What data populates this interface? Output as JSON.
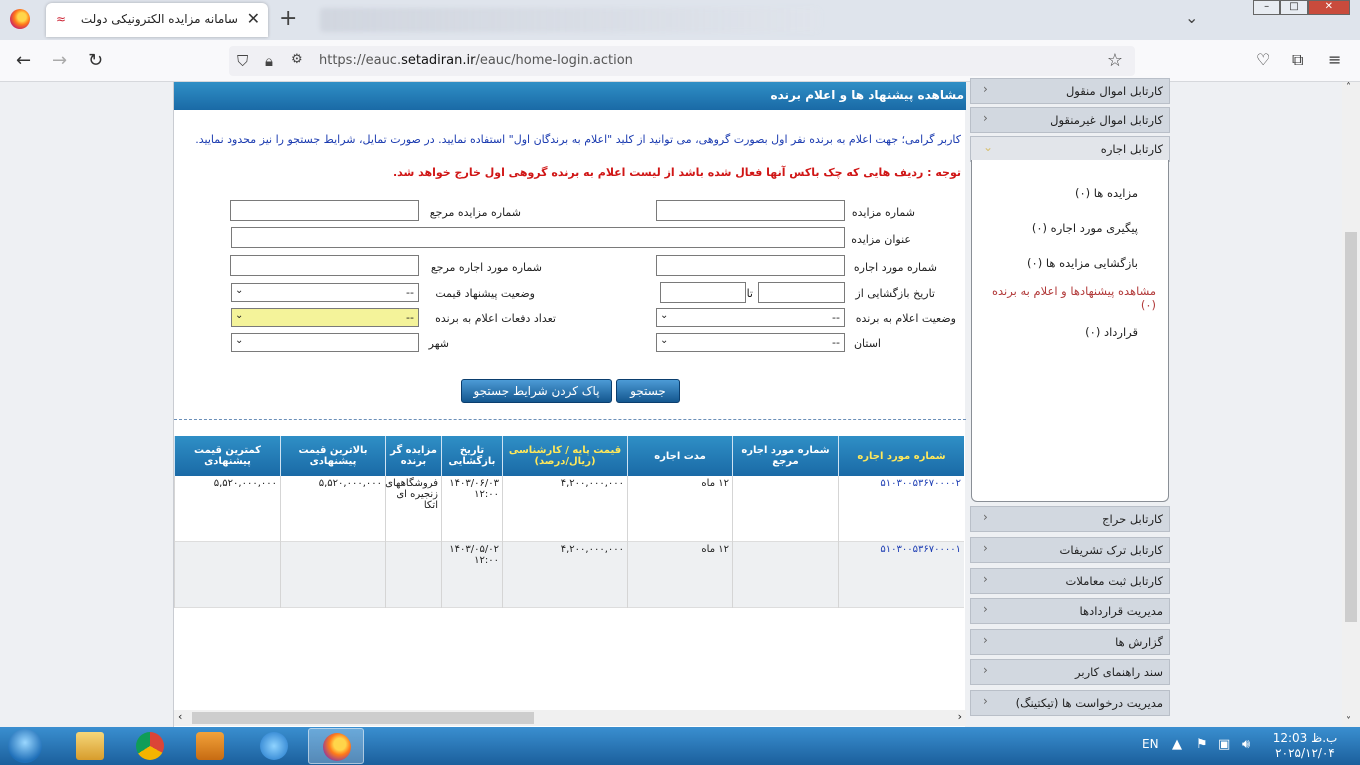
{
  "browser": {
    "tab_title": "سامانه مزایده الکترونیکی دولت",
    "tab_close": "✕",
    "new_tab": "+",
    "url_scheme": "https://eauc.",
    "url_domain": "setadiran.ir",
    "url_path": "/eauc/home-login.action"
  },
  "page": {
    "header_title": "مشاهده پیشنهاد ها و اعلام برنده",
    "info_text": "کاربر گرامی؛ جهت اعلام به برنده نفر اول بصورت گروهی، می توانید از کلید \"اعلام به برندگان اول\" استفاده نمایید. در صورت تمایل، شرایط جستجو را نیز محدود نمایید.",
    "warning_text": "توجه : ردیف هایی که چک باکس آنها فعال شده باشد از لیست اعلام به برنده گروهی اول خارج خواهد شد."
  },
  "form": {
    "auction_no_label": "شماره مزایده",
    "ref_auction_no_label": "شماره مزایده مرجع",
    "auction_title_label": "عنوان مزایده",
    "lease_item_no_label": "شماره مورد اجاره",
    "ref_lease_item_no_label": "شماره مورد اجاره مرجع",
    "opening_date_from_label": "تاریخ بازگشایی از",
    "to_label": "تا",
    "price_offer_status_label": "وضعیت پیشنهاد قیمت",
    "price_offer_status_value": "--",
    "winner_announce_status_label": "وضعیت اعلام به برنده",
    "winner_announce_status_value": "--",
    "announce_count_label": "تعداد دفعات اعلام به برنده",
    "announce_count_value": "--",
    "province_label": "استان",
    "province_value": "--",
    "city_label": "شهر",
    "city_value": "",
    "search_button": "جستجو",
    "clear_button": "پاک کردن شرایط جستجو"
  },
  "table": {
    "columns": [
      "شماره مورد اجاره",
      "شماره مورد اجاره مرجع",
      "مدت اجاره",
      "قیمت پایه / کارشناسی (ریال/درصد)",
      "تاریخ بازگشایی",
      "مزایده گر برنده",
      "بالاترین قیمت پیشنهادی",
      "کمترین قیمت پیشنهادی"
    ],
    "rows": [
      {
        "lease_no": "۵۱۰۳۰۰۵۳۶۷۰۰۰۰۲",
        "ref_no": "",
        "duration": "۱۲ ماه",
        "base_price": "۴,۲۰۰,۰۰۰,۰۰۰",
        "opening_date": "۱۴۰۳/۰۶/۰۳ ۱۲:۰۰",
        "winner": "فروشگاههای زنجیره ای اتکا",
        "max_price": "۵,۵۲۰,۰۰۰,۰۰۰",
        "min_price": "۵,۵۲۰,۰۰۰,۰۰۰"
      },
      {
        "lease_no": "۵۱۰۳۰۰۵۳۶۷۰۰۰۰۱",
        "ref_no": "",
        "duration": "۱۲ ماه",
        "base_price": "۴,۲۰۰,۰۰۰,۰۰۰",
        "opening_date": "۱۴۰۳/۰۵/۰۲ ۱۲:۰۰",
        "winner": "",
        "max_price": "",
        "min_price": ""
      }
    ]
  },
  "sidebar": {
    "menus_top": [
      "کارتابل اموال منقول",
      "کارتابل اموال غیرمنقول",
      "کارتابل اجاره"
    ],
    "submenu": [
      "مزایده ها (۰)",
      "پیگیری مورد اجاره (۰)",
      "بازگشایی مزایده ها (۰)",
      "مشاهده پیشنهادها و اعلام به برنده (۰)",
      "قرارداد (۰)"
    ],
    "menus_bottom": [
      "کارتابل حراج",
      "کارتابل ترک تشریفات",
      "کارتابل ثبت معاملات",
      "مدیریت قراردادها",
      "گزارش ها",
      "سند راهنمای کاربر",
      "مدیریت درخواست ها (تیکتینگ)"
    ]
  },
  "taskbar": {
    "lang": "EN",
    "time": "ب.ظ 12:03",
    "date": "۲۰۲۵/۱۲/۰۴"
  }
}
